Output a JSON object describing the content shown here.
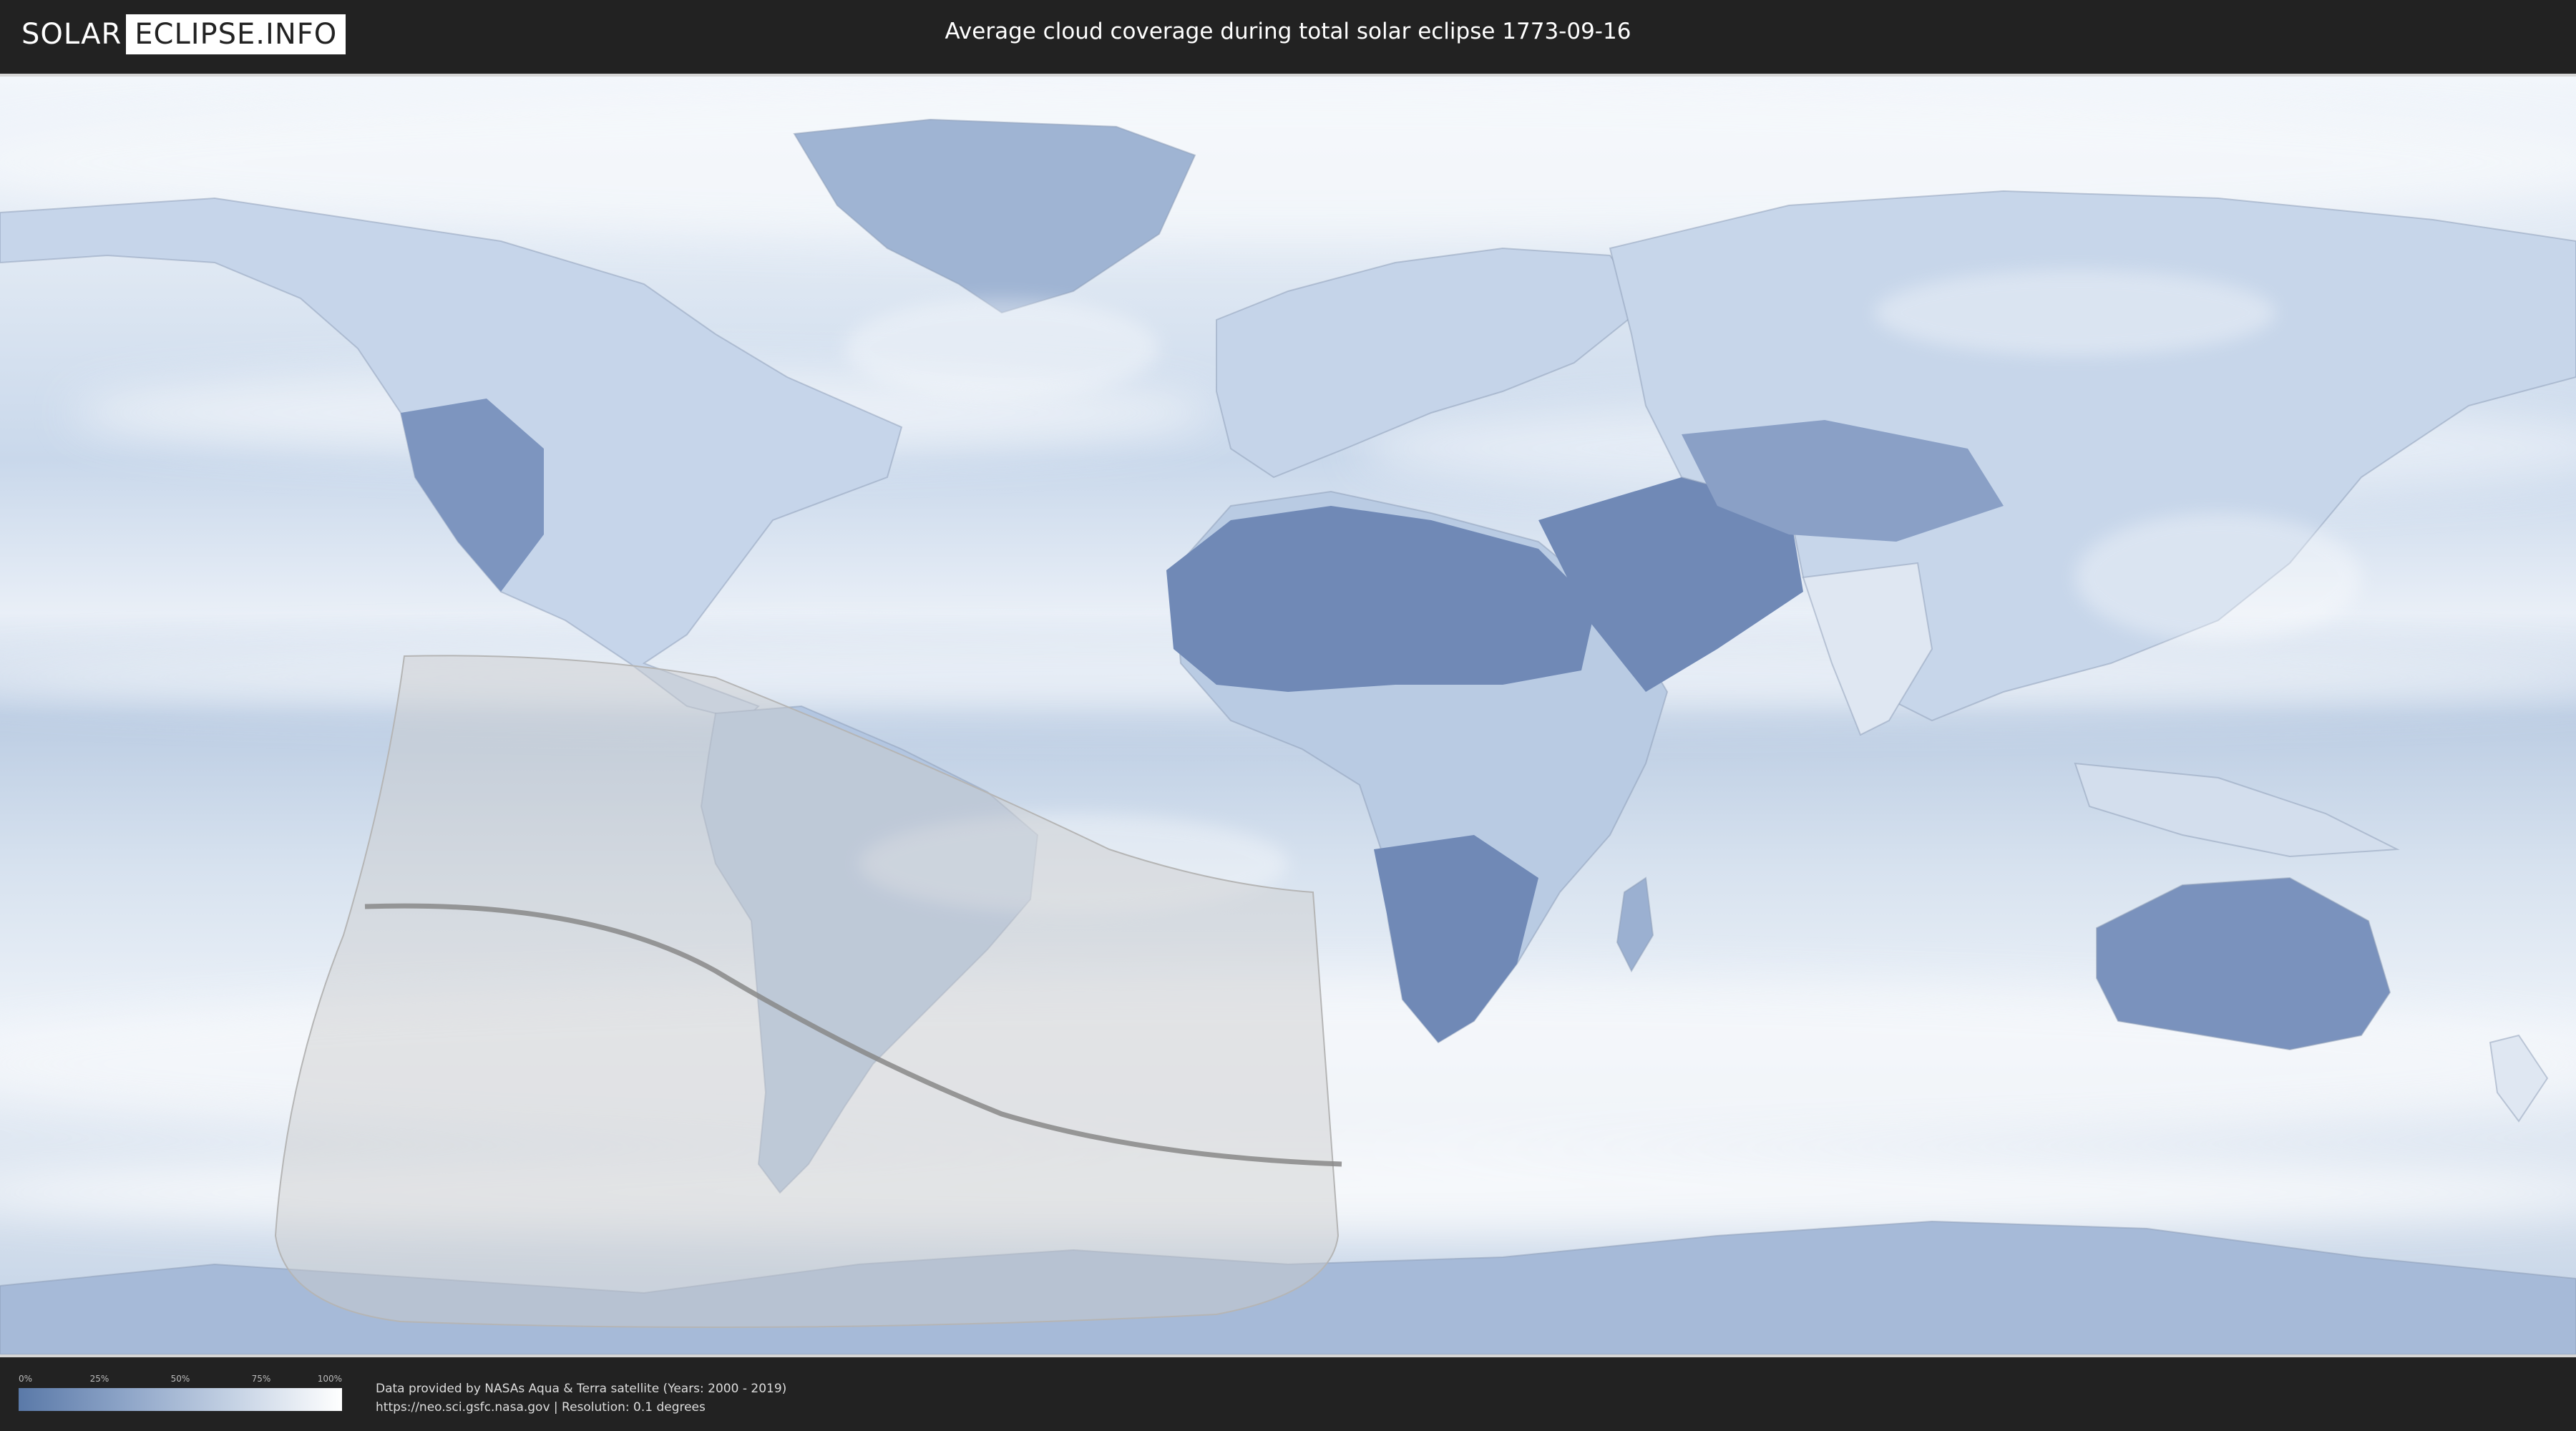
{
  "header": {
    "logo_part1": "SOLAR",
    "logo_part2": "ECLIPSE.INFO",
    "title": "Average cloud coverage during total solar eclipse 1773-09-16"
  },
  "legend": {
    "ticks": [
      "0%",
      "25%",
      "50%",
      "75%",
      "100%"
    ],
    "colors": {
      "low": "#5a79a8",
      "mid": "#c5d2e4",
      "high": "#ffffff"
    }
  },
  "credits": {
    "line1": "Data provided by NASAs Aqua & Terra satellite (Years: 2000 - 2019)",
    "line2": "https://neo.sci.gsfc.nasa.gov | Resolution: 0.1 degrees"
  },
  "map": {
    "projection": "equirectangular",
    "ocean_color": "#b9cbe2",
    "land_dark_color": "#7089b6",
    "cloud_color": "#f4f7fb",
    "eclipse_area_color": "#cccccc",
    "central_line_color": "#888888"
  }
}
